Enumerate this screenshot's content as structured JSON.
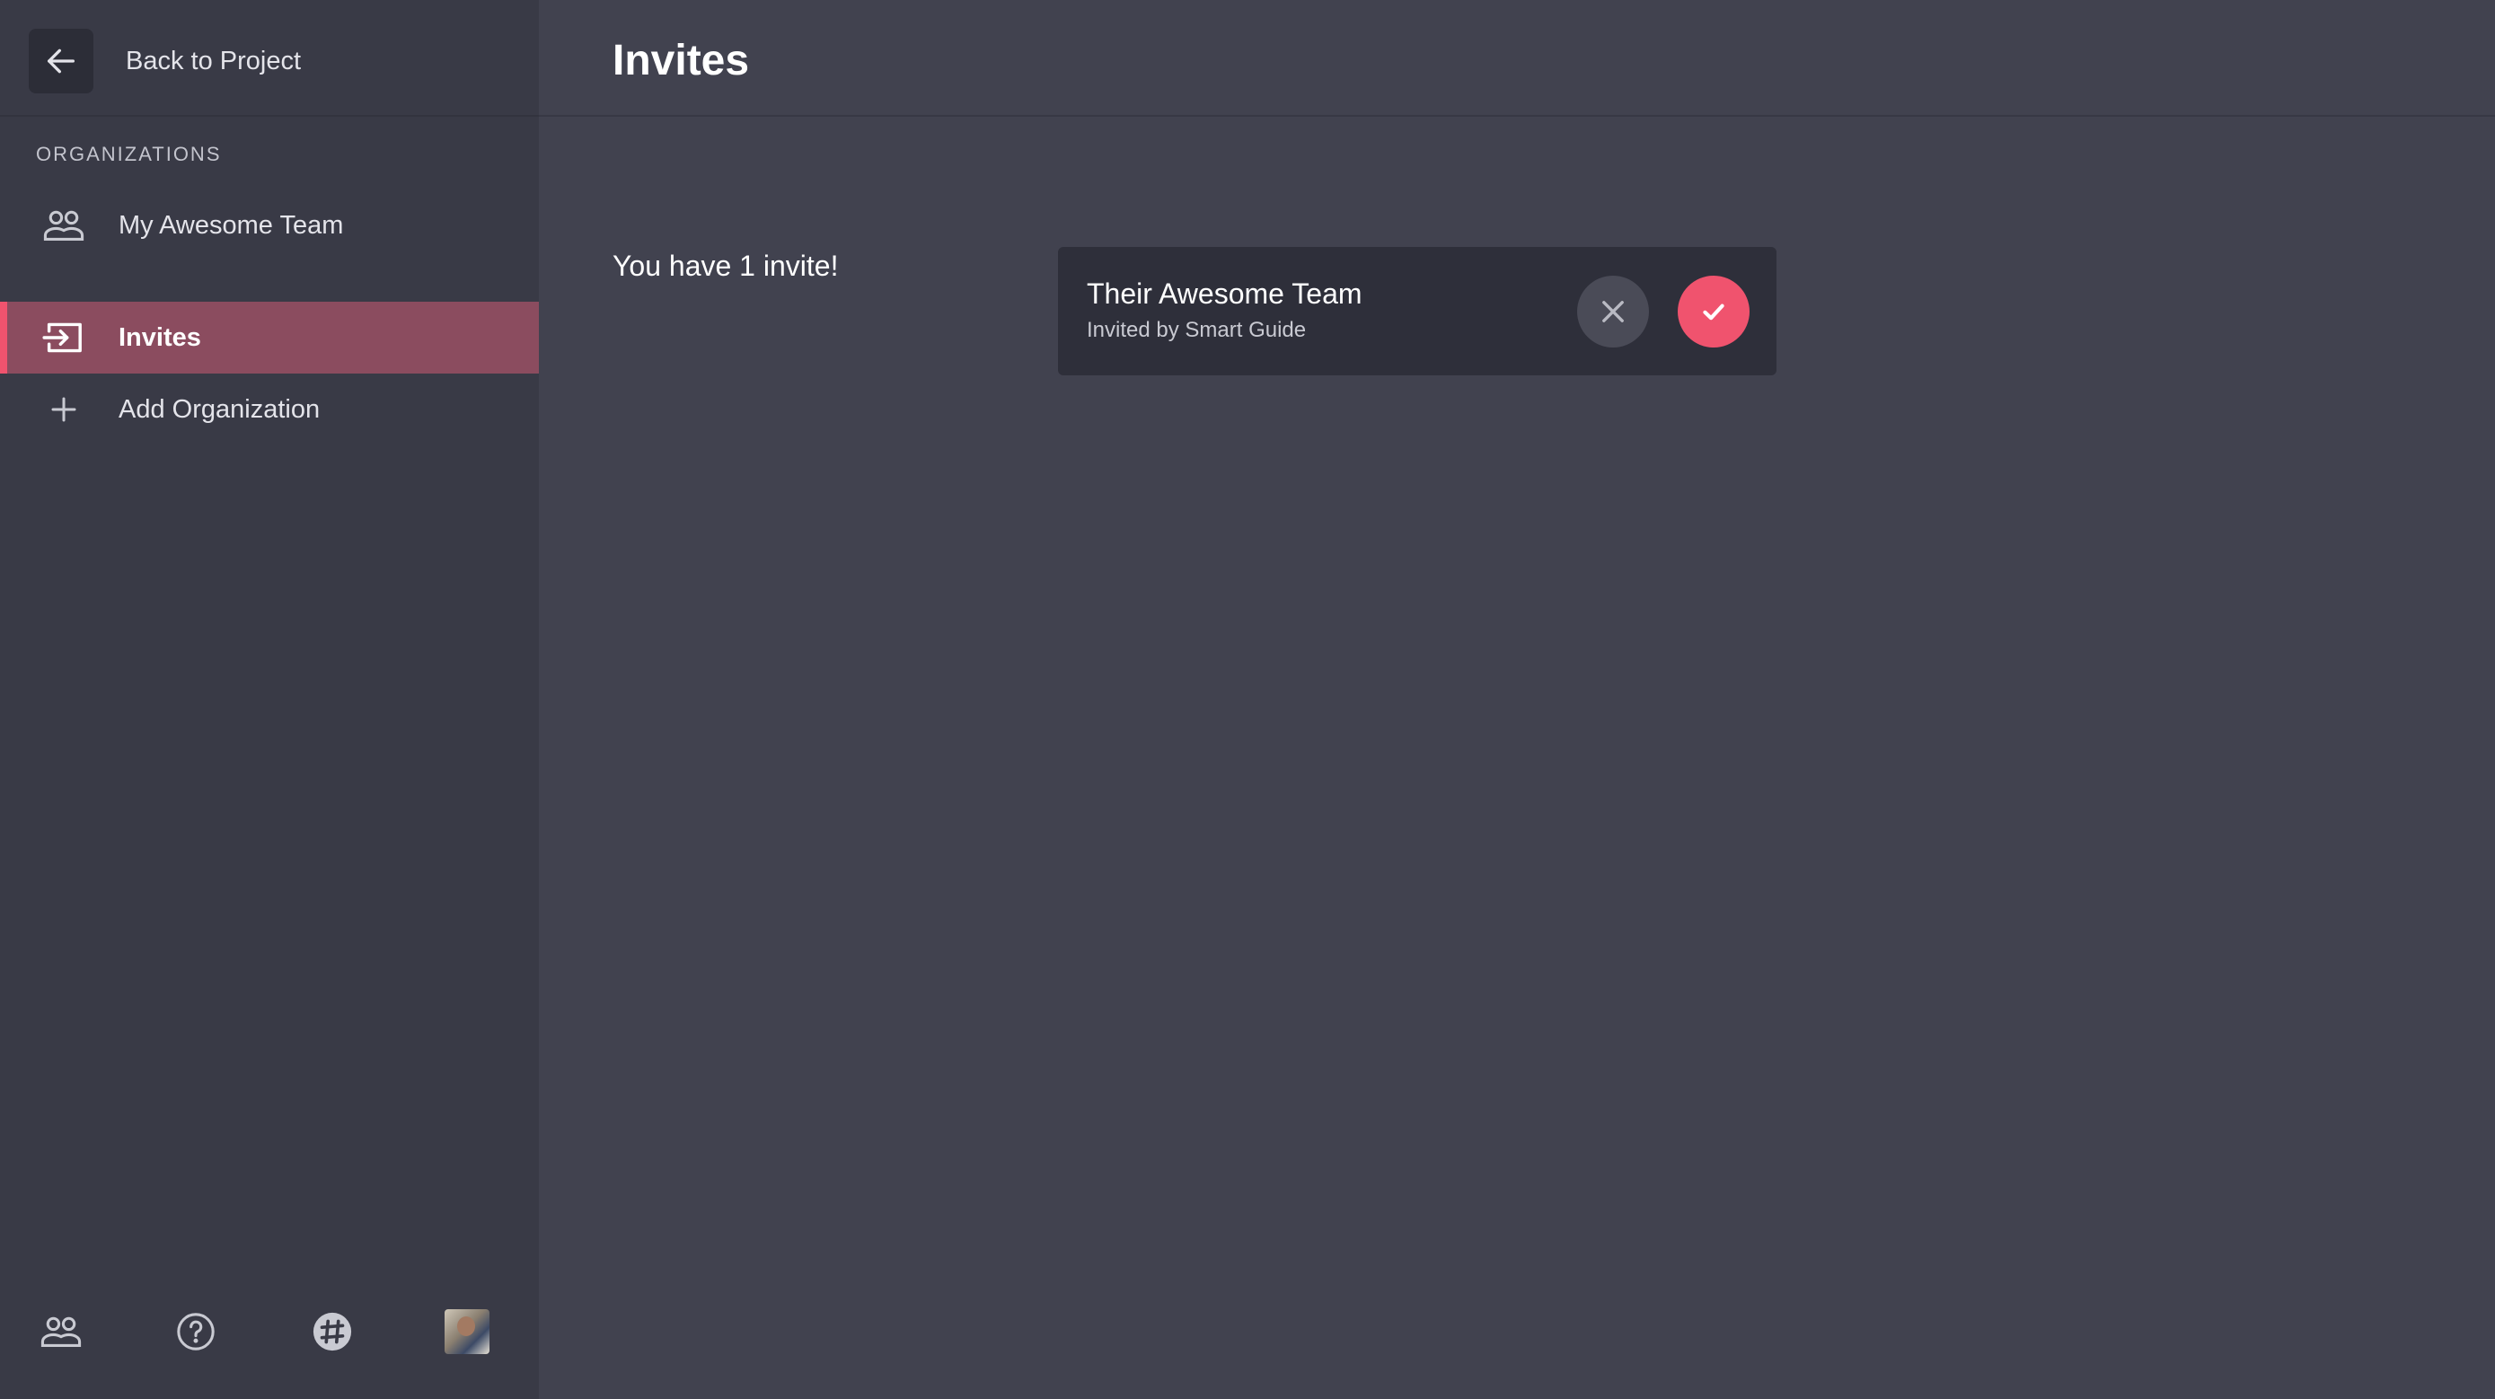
{
  "sidebar": {
    "back_label": "Back to Project",
    "section_title": "ORGANIZATIONS",
    "items": [
      {
        "label": "My Awesome Team",
        "icon": "team-icon"
      },
      {
        "label": "Invites",
        "icon": "invite-icon",
        "active": true
      },
      {
        "label": "Add Organization",
        "icon": "plus-icon"
      }
    ],
    "footer": [
      "team-icon",
      "help-icon",
      "slack-icon",
      "avatar"
    ]
  },
  "main": {
    "title": "Invites",
    "invite_count_text": "You have 1 invite!",
    "invites": [
      {
        "team": "Their Awesome Team",
        "invited_by": "Invited by Smart Guide"
      }
    ]
  },
  "colors": {
    "accent": "#f0536e",
    "sidebar_bg": "#393a46",
    "main_bg": "#41424f",
    "card_bg": "#2e2f3a",
    "active_bg": "#8b4c5f"
  }
}
